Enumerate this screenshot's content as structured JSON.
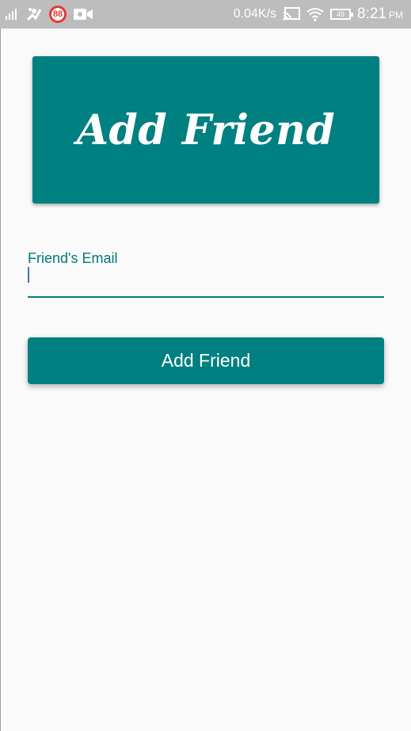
{
  "status_bar": {
    "left_icons": [
      "signal-icon",
      "usb-debug-icon",
      "badge-icon",
      "video-call-icon"
    ],
    "badge_count": "88",
    "network_speed": "0.04K/s",
    "right_icons": [
      "cast-icon",
      "wifi-icon",
      "battery-icon"
    ],
    "battery_level": "49",
    "time": "8:21",
    "ampm": "PM"
  },
  "header": {
    "title": "Add Friend"
  },
  "form": {
    "email_label": "Friend's Email",
    "email_value": ""
  },
  "actions": {
    "add_button_label": "Add Friend"
  },
  "colors": {
    "primary": "#008080",
    "status_bar": "#bdbdbd",
    "background": "#fafafa",
    "cursor": "#3d6fd8"
  }
}
